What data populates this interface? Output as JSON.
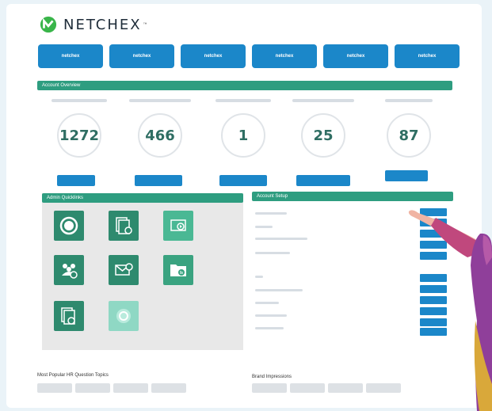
{
  "brand": {
    "name": "NETCHEX",
    "trademark": "™"
  },
  "tabs": [
    {
      "label": "netchex"
    },
    {
      "label": "netchex"
    },
    {
      "label": "netchex"
    },
    {
      "label": "netchex"
    },
    {
      "label": "netchex"
    },
    {
      "label": "netchex"
    }
  ],
  "account_overview": {
    "title": "Account Overview",
    "metrics": [
      {
        "value": "1272"
      },
      {
        "value": "466"
      },
      {
        "value": "1"
      },
      {
        "value": "25"
      },
      {
        "value": "87"
      }
    ]
  },
  "quicklinks": {
    "title": "Admin Quicklinks",
    "tiles": [
      {
        "icon": "current-card-icon",
        "color": "#2e8a6e"
      },
      {
        "icon": "documents-clock-icon",
        "color": "#2e8a6e"
      },
      {
        "icon": "video-play-icon",
        "color": "#4ab894"
      },
      {
        "icon": "team-people-icon",
        "color": "#2e8a6e"
      },
      {
        "icon": "envelope-check-icon",
        "color": "#2e8a6e"
      },
      {
        "icon": "folder-chart-icon",
        "color": "#3aa380"
      },
      {
        "icon": "documents-check-icon",
        "color": "#2e8a6e"
      },
      {
        "icon": "glow-circle-icon",
        "color": "#8fd8c4"
      }
    ]
  },
  "account_setup": {
    "title": "Account Setup"
  },
  "footer": {
    "popular_topics": "Most Popular HR Question Topics",
    "brand_impressions": "Brand Impressions"
  },
  "colors": {
    "accent_blue": "#1b87c9",
    "accent_green": "#2e9d80"
  }
}
